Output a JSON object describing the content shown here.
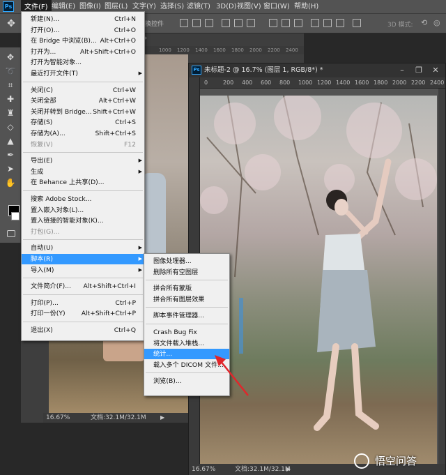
{
  "app": {
    "logo_text": "Ps"
  },
  "menubar": {
    "items": [
      "文件(F)",
      "编辑(E)",
      "图像(I)",
      "图层(L)",
      "文字(Y)",
      "选择(S)",
      "滤镜(T)",
      "3D(D)",
      "视图(V)",
      "窗口(W)",
      "帮助(H)"
    ],
    "active_index": 0
  },
  "options_bar": {
    "transform_label": "换控件",
    "mode_label": "3D 模式:"
  },
  "back_document": {
    "tab_suffix": "8\") *",
    "ruler_labels": [
      "1000",
      "1200",
      "1400",
      "1600",
      "1800",
      "2000",
      "2200",
      "2400"
    ],
    "zoom": "16.67%",
    "doc_info": "文档:32.1M/32.1M"
  },
  "document": {
    "title": "未标题-2 @ 16.7% (图层 1, RGB/8*) *",
    "ruler_labels": [
      "0",
      "200",
      "400",
      "600",
      "800",
      "1000",
      "1200",
      "1400",
      "1600",
      "1800",
      "2000",
      "2200",
      "2400"
    ],
    "zoom": "16.67%",
    "doc_info": "文档:32.1M/32.1M",
    "minimize": "–",
    "restore": "❐",
    "close": "✕"
  },
  "file_menu": {
    "items": [
      {
        "label": "新建(N)...",
        "shortcut": "Ctrl+N"
      },
      {
        "label": "打开(O)...",
        "shortcut": "Ctrl+O"
      },
      {
        "label": "在 Bridge 中浏览(B)...",
        "shortcut": "Alt+Ctrl+O"
      },
      {
        "label": "打开为...",
        "shortcut": "Alt+Shift+Ctrl+O"
      },
      {
        "label": "打开为智能对象...",
        "shortcut": ""
      },
      {
        "label": "最近打开文件(T)",
        "shortcut": "",
        "submenu": true
      },
      {
        "sep": true
      },
      {
        "label": "关闭(C)",
        "shortcut": "Ctrl+W"
      },
      {
        "label": "关闭全部",
        "shortcut": "Alt+Ctrl+W"
      },
      {
        "label": "关闭并转到 Bridge...",
        "shortcut": "Shift+Ctrl+W"
      },
      {
        "label": "存储(S)",
        "shortcut": "Ctrl+S"
      },
      {
        "label": "存储为(A)...",
        "shortcut": "Shift+Ctrl+S"
      },
      {
        "label": "恢复(V)",
        "shortcut": "F12",
        "disabled": true
      },
      {
        "sep": true
      },
      {
        "label": "导出(E)",
        "shortcut": "",
        "submenu": true
      },
      {
        "label": "生成",
        "shortcut": "",
        "submenu": true
      },
      {
        "label": "在 Behance 上共享(D)...",
        "shortcut": ""
      },
      {
        "sep": true
      },
      {
        "label": "搜索 Adobe Stock...",
        "shortcut": ""
      },
      {
        "label": "置入嵌入对象(L)...",
        "shortcut": ""
      },
      {
        "label": "置入链接的智能对象(K)...",
        "shortcut": ""
      },
      {
        "label": "打包(G)...",
        "shortcut": "",
        "disabled": true
      },
      {
        "sep": true
      },
      {
        "label": "自动(U)",
        "shortcut": "",
        "submenu": true
      },
      {
        "label": "脚本(R)",
        "shortcut": "",
        "submenu": true,
        "highlighted": true
      },
      {
        "label": "导入(M)",
        "shortcut": "",
        "submenu": true
      },
      {
        "sep": true
      },
      {
        "label": "文件简介(F)...",
        "shortcut": "Alt+Shift+Ctrl+I"
      },
      {
        "sep": true
      },
      {
        "label": "打印(P)...",
        "shortcut": "Ctrl+P"
      },
      {
        "label": "打印一份(Y)",
        "shortcut": "Alt+Shift+Ctrl+P"
      },
      {
        "sep": true
      },
      {
        "label": "退出(X)",
        "shortcut": "Ctrl+Q"
      }
    ]
  },
  "script_menu": {
    "items": [
      {
        "label": "图像处理器..."
      },
      {
        "label": "删除所有空图层"
      },
      {
        "sep": true
      },
      {
        "label": "拼合所有蒙版"
      },
      {
        "label": "拼合所有图层效果"
      },
      {
        "sep": true
      },
      {
        "label": "脚本事件管理器..."
      },
      {
        "sep": true
      },
      {
        "label": "Crash Bug Fix"
      },
      {
        "label": "将文件载入堆栈..."
      },
      {
        "label": "统计...",
        "highlighted": true
      },
      {
        "label": "载入多个 DICOM 文件..."
      },
      {
        "sep": true
      },
      {
        "label": "浏览(B)..."
      }
    ]
  },
  "watermark": {
    "text": "悟空问答"
  },
  "colors": {
    "menu_highlight": "#3399ff",
    "arrow": "#e0262b",
    "ps_blue": "#31a8ff"
  }
}
